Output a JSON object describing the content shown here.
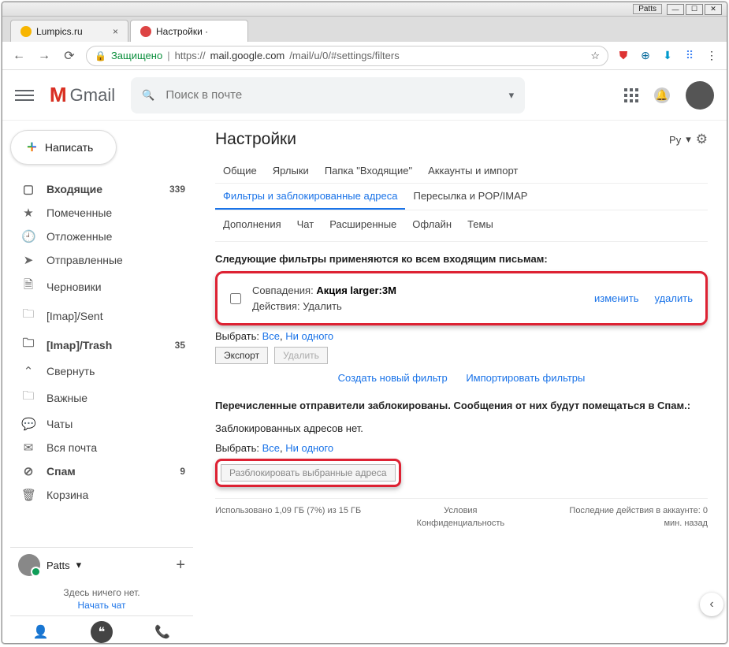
{
  "window": {
    "title": "Patts",
    "min": "—",
    "max": "☐",
    "close": "✕"
  },
  "tabs": {
    "t1": {
      "title": "Lumpics.ru",
      "close": "×"
    },
    "t2": {
      "title": "Настройки ·",
      "close": ""
    }
  },
  "nav": {
    "back": "←",
    "forward": "→",
    "reload": "⟳"
  },
  "url": {
    "lock": "🔒",
    "secure": "Защищено",
    "proto": "https://",
    "host": "mail.google.com",
    "path": "/mail/u/0/#settings/filters",
    "star": "☆"
  },
  "ext": {
    "e1": "⛊",
    "e2": "⊕",
    "e3": "⬇",
    "e4": "⠿",
    "menu": "⋮"
  },
  "header": {
    "logo": "Gmail",
    "search_placeholder": "Поиск в почте",
    "search_icon": "🔍",
    "dropdown": "▾",
    "bell": "🔔"
  },
  "compose": {
    "label": "Написать",
    "plus": "+"
  },
  "folders": [
    {
      "icon": "▢",
      "label": "Входящие",
      "count": "339",
      "bold": true
    },
    {
      "icon": "★",
      "label": "Помеченные",
      "count": ""
    },
    {
      "icon": "🕘",
      "label": "Отложенные",
      "count": ""
    },
    {
      "icon": "➤",
      "label": "Отправленные",
      "count": ""
    },
    {
      "icon": "🗎",
      "label": "Черновики",
      "count": ""
    },
    {
      "icon": "🗀",
      "label": "[Imap]/Sent",
      "count": ""
    },
    {
      "icon": "🗀",
      "label": "[Imap]/Trash",
      "count": "35",
      "bold": true
    },
    {
      "icon": "⌃",
      "label": "Свернуть",
      "count": ""
    },
    {
      "icon": "🗀",
      "label": "Важные",
      "count": ""
    },
    {
      "icon": "💬",
      "label": "Чаты",
      "count": ""
    },
    {
      "icon": "✉",
      "label": "Вся почта",
      "count": ""
    },
    {
      "icon": "⊘",
      "label": "Спам",
      "count": "9",
      "bold": true
    },
    {
      "icon": "🗑",
      "label": "Корзина",
      "count": ""
    }
  ],
  "hangouts": {
    "user": "Patts",
    "caret": "▾",
    "plus": "+",
    "empty": "Здесь ничего нет.",
    "start": "Начать чат",
    "tab_person": "👤",
    "tab_chat": "❝",
    "tab_call": "📞"
  },
  "settings": {
    "title": "Настройки",
    "lang": "Ру",
    "caret": "▾",
    "gear": "⚙",
    "tabs1": [
      "Общие",
      "Ярлыки",
      "Папка \"Входящие\"",
      "Аккаунты и импорт"
    ],
    "active_tab": "Фильтры и заблокированные адреса",
    "tab_pop": "Пересылка и POP/IMAP",
    "tabs2": [
      "Дополнения",
      "Чат",
      "Расширенные",
      "Офлайн",
      "Темы"
    ],
    "filters_heading": "Следующие фильтры применяются ко всем входящим письмам:",
    "filter": {
      "match_label": "Совпадения: ",
      "match_value": "Акция larger:3M",
      "action_label": "Действия: ",
      "action_value": "Удалить",
      "edit": "изменить",
      "delete": "удалить"
    },
    "select_label": "Выбрать: ",
    "select_all": "Все",
    "select_none": "Ни одного",
    "export_btn": "Экспорт",
    "delete_btn": "Удалить",
    "create_filter": "Создать новый фильтр",
    "import_filters": "Импортировать фильтры",
    "blocked_heading": "Перечисленные отправители заблокированы. Сообщения от них будут помещаться в Спам.:",
    "no_blocked": "Заблокированных адресов нет.",
    "unblock_btn": "Разблокировать выбранные адреса"
  },
  "footer": {
    "storage": "Использовано 1,09 ГБ (7%) из 15 ГБ",
    "terms1": "Условия",
    "terms2": "Конфиденциальность",
    "activity": "Последние действия в аккаунте: 0 мин. назад"
  },
  "fab": "‹"
}
